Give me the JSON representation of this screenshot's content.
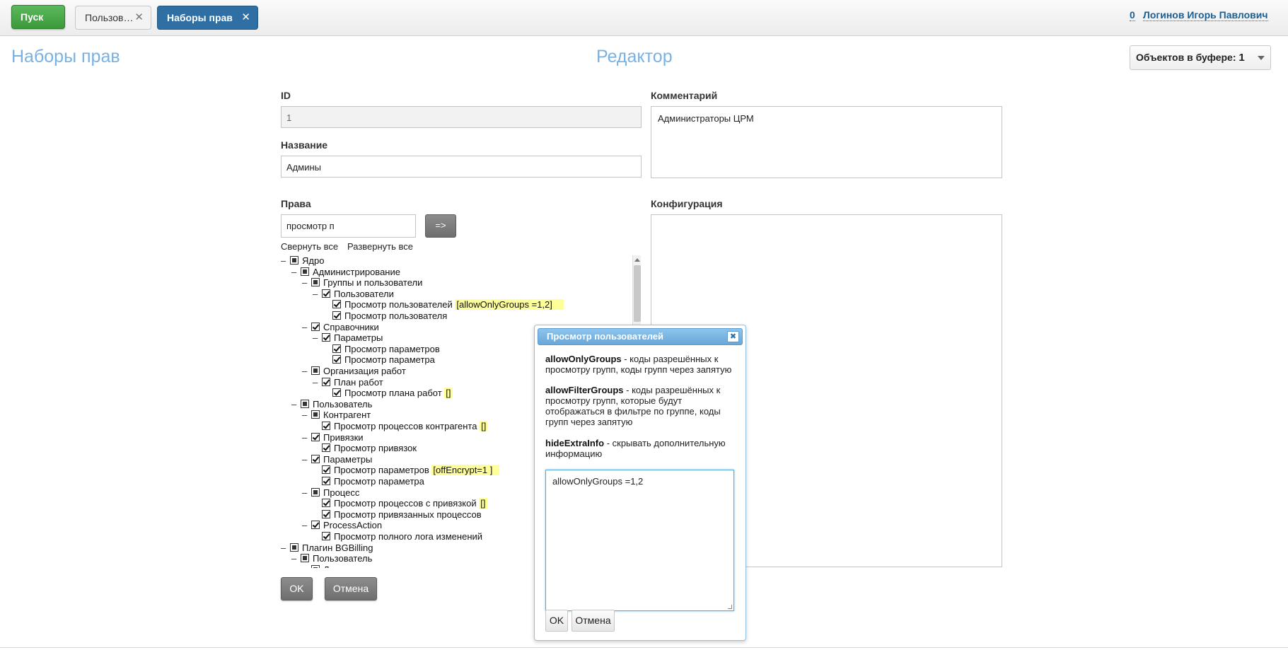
{
  "topbar": {
    "start_label": "Пуск",
    "tabs": [
      {
        "label": "Пользов…",
        "close": "✕"
      },
      {
        "label": "Наборы прав",
        "close": "✕"
      }
    ],
    "user_count": "0",
    "user_name": "Логинов Игорь Павлович"
  },
  "header": {
    "left_title": "Наборы прав",
    "center_title": "Редактор",
    "buffer_label": "Объектов в буфере:",
    "buffer_count": "1"
  },
  "form": {
    "id_label": "ID",
    "id_value": "1",
    "name_label": "Название",
    "name_value": "Админы",
    "comment_label": "Комментарий",
    "comment_value": "Администраторы ЦРМ",
    "perms_label": "Права",
    "filter_value": "просмотр п",
    "go_label": "=>",
    "collapse_all": "Свернуть все",
    "expand_all": "Развернуть все",
    "config_label": "Конфигурация",
    "config_value": "",
    "ok_label": "OK",
    "cancel_label": "Отмена"
  },
  "tree": [
    {
      "text": "Ядро",
      "state": "partial",
      "level": 0,
      "minus": true
    },
    {
      "text": "Администрирование",
      "state": "partial",
      "level": 1,
      "minus": true
    },
    {
      "text": "Группы и пользователи",
      "state": "partial",
      "level": 2,
      "minus": true
    },
    {
      "text": "Пользователи",
      "state": "check",
      "level": 3,
      "minus": true
    },
    {
      "text": "Просмотр пользователей",
      "state": "check",
      "level": 4,
      "minus": false,
      "config": "[allowOnlyGroups =1,2]    "
    },
    {
      "text": "Просмотр пользователя",
      "state": "check",
      "level": 4,
      "minus": false
    },
    {
      "text": "Справочники",
      "state": "check",
      "level": 2,
      "minus": true
    },
    {
      "text": "Параметры",
      "state": "check",
      "level": 3,
      "minus": true
    },
    {
      "text": "Просмотр параметров",
      "state": "check",
      "level": 4,
      "minus": false
    },
    {
      "text": "Просмотр параметра",
      "state": "check",
      "level": 4,
      "minus": false
    },
    {
      "text": "Организация работ",
      "state": "partial",
      "level": 2,
      "minus": true
    },
    {
      "text": "План работ",
      "state": "check",
      "level": 3,
      "minus": true
    },
    {
      "text": "Просмотр плана работ",
      "state": "check",
      "level": 4,
      "minus": false,
      "config": "[]"
    },
    {
      "text": "Пользователь",
      "state": "partial",
      "level": 1,
      "minus": true
    },
    {
      "text": "Контрагент",
      "state": "partial",
      "level": 2,
      "minus": true
    },
    {
      "text": "Просмотр процессов контрагента",
      "state": "check",
      "level": 3,
      "minus": false,
      "config": "[]"
    },
    {
      "text": "Привязки",
      "state": "check",
      "level": 2,
      "minus": true
    },
    {
      "text": "Просмотр привязок",
      "state": "check",
      "level": 3,
      "minus": false
    },
    {
      "text": "Параметры",
      "state": "check",
      "level": 2,
      "minus": true
    },
    {
      "text": "Просмотр параметров",
      "state": "check",
      "level": 3,
      "minus": false,
      "config": "[offEncrypt=1 ]  "
    },
    {
      "text": "Просмотр параметра",
      "state": "check",
      "level": 3,
      "minus": false
    },
    {
      "text": "Процесс",
      "state": "partial",
      "level": 2,
      "minus": true
    },
    {
      "text": "Просмотр процессов с привязкой",
      "state": "check",
      "level": 3,
      "minus": false,
      "config": "[]"
    },
    {
      "text": "Просмотр привязанных процессов",
      "state": "check",
      "level": 3,
      "minus": false
    },
    {
      "text": "ProcessAction",
      "state": "check",
      "level": 2,
      "minus": true
    },
    {
      "text": "Просмотр полного лога изменений",
      "state": "check",
      "level": 3,
      "minus": false
    },
    {
      "text": "Плагин BGBilling",
      "state": "partial",
      "level": 0,
      "minus": true
    },
    {
      "text": "Пользователь",
      "state": "partial",
      "level": 1,
      "minus": true
    },
    {
      "text": "Договор",
      "state": "partial",
      "level": 2,
      "minus": true
    }
  ],
  "dialog": {
    "title": "Просмотр пользователей",
    "close": "✖",
    "params": [
      {
        "name": "allowOnlyGroups",
        "desc": " - коды разрешённых к просмотру групп, коды групп через запятую"
      },
      {
        "name": "allowFilterGroups",
        "desc": " - коды разрешённых к просмотру групп, которые будут отображаться в фильтре по группе, коды групп через запятую"
      },
      {
        "name": "hideExtraInfo",
        "desc": " - скрывать дополнительную информацию"
      }
    ],
    "value": "allowOnlyGroups =1,2",
    "ok_label": "OK",
    "cancel_label": "Отмена"
  }
}
